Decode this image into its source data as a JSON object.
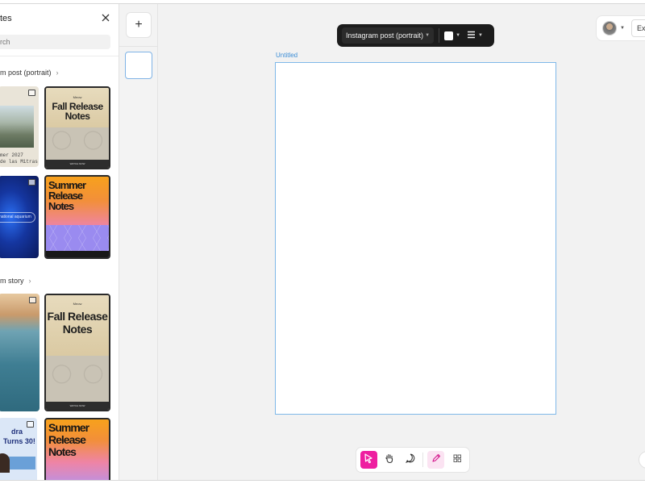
{
  "panel": {
    "title": "tes",
    "search_placeholder": "rch",
    "sections": [
      {
        "title": "m post (portrait)"
      },
      {
        "title": "m story"
      }
    ]
  },
  "templates": {
    "mountain_caption_1": "mer 2027",
    "mountain_caption_2": "de las Mitras",
    "aqua_text": "national aquarium",
    "turns_text_1": "dra",
    "turns_text_2": "Turns 30!",
    "fall_brand": "Meow",
    "fall_headline": [
      "Fall Release",
      "Notes"
    ],
    "fall_footer": "WATCH NOW",
    "summer_headline": [
      "Summer",
      "Release",
      "Notes"
    ]
  },
  "pages": {
    "add_label": "+"
  },
  "toolbar": {
    "size_label": "Instagram post (portrait)",
    "swatch_color": "#ffffff"
  },
  "topright": {
    "export_label": "Exp"
  },
  "canvas": {
    "title": "Untitled"
  },
  "colors": {
    "accent": "#ee1fa0",
    "selection": "#7fb8e8"
  },
  "icons": [
    "close-icon",
    "chevron-right-icon",
    "plus-icon",
    "chevron-down-icon",
    "align-icon",
    "select-pointer-icon",
    "hand-icon",
    "comment-icon",
    "draw-icon",
    "grid-icon"
  ]
}
